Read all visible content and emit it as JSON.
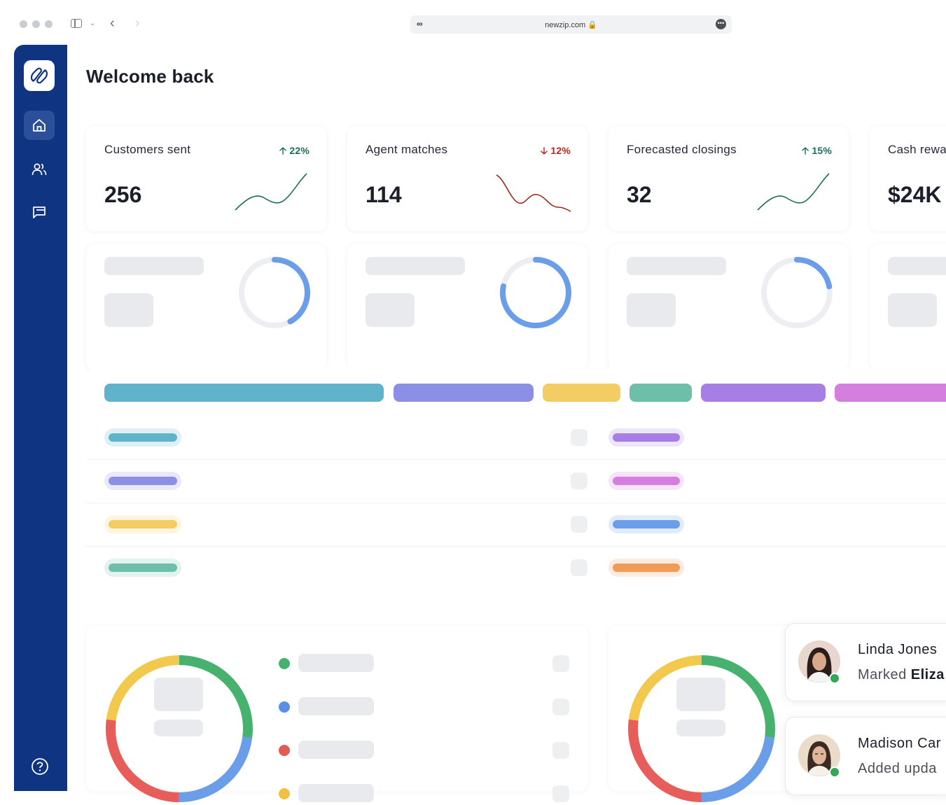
{
  "browser": {
    "url": "newzip.com",
    "colors": {
      "dots": "#c9ccd1"
    }
  },
  "app": {
    "logo_icon": "newzip-logo-icon",
    "brand_color": "#0f3482",
    "sidebar": [
      {
        "name": "home",
        "icon": "home-icon",
        "active": true
      },
      {
        "name": "people",
        "icon": "users-icon",
        "active": false
      },
      {
        "name": "messages",
        "icon": "chat-icon",
        "active": false
      }
    ],
    "help_icon": "help-icon"
  },
  "page": {
    "title": "Welcome back"
  },
  "stats": [
    {
      "label": "Customers sent",
      "value": "256",
      "change": "22%",
      "direction": "up",
      "trend_color": "#1d6b5b"
    },
    {
      "label": "Agent matches",
      "value": "114",
      "change": "12%",
      "direction": "down",
      "trend_color": "#9b2c1f"
    },
    {
      "label": "Forecasted closings",
      "value": "32",
      "change": "15%",
      "direction": "up",
      "trend_color": "#1d6b5b"
    },
    {
      "label": "Cash rewa",
      "value": "$24K"
    }
  ],
  "rings": [
    {
      "fraction": 0.42,
      "color": "#6b9ee8"
    },
    {
      "fraction": 0.78,
      "color": "#6b9ee8"
    },
    {
      "fraction": 0.22,
      "color": "#6b9ee8"
    }
  ],
  "segments": [
    {
      "color": "#5fb4cc"
    },
    {
      "color": "#8b8fe6"
    },
    {
      "color": "#f3cc63"
    },
    {
      "color": "#6dbfaa"
    },
    {
      "color": "#a77ee6"
    },
    {
      "color": "#d47ee0"
    }
  ],
  "legend_colors": [
    "#47b26e",
    "#5b8ee6",
    "#e25b55",
    "#f2c143"
  ],
  "donut_colors": {
    "green": "#47b26e",
    "blue": "#6b9ee8",
    "red": "#e65d5a",
    "yellow": "#f2c94c"
  },
  "activity": [
    {
      "name": "Linda Jones",
      "verb": "Marked",
      "target": "Eliza"
    },
    {
      "name": "Madison Car",
      "verb": "Added upda"
    }
  ]
}
